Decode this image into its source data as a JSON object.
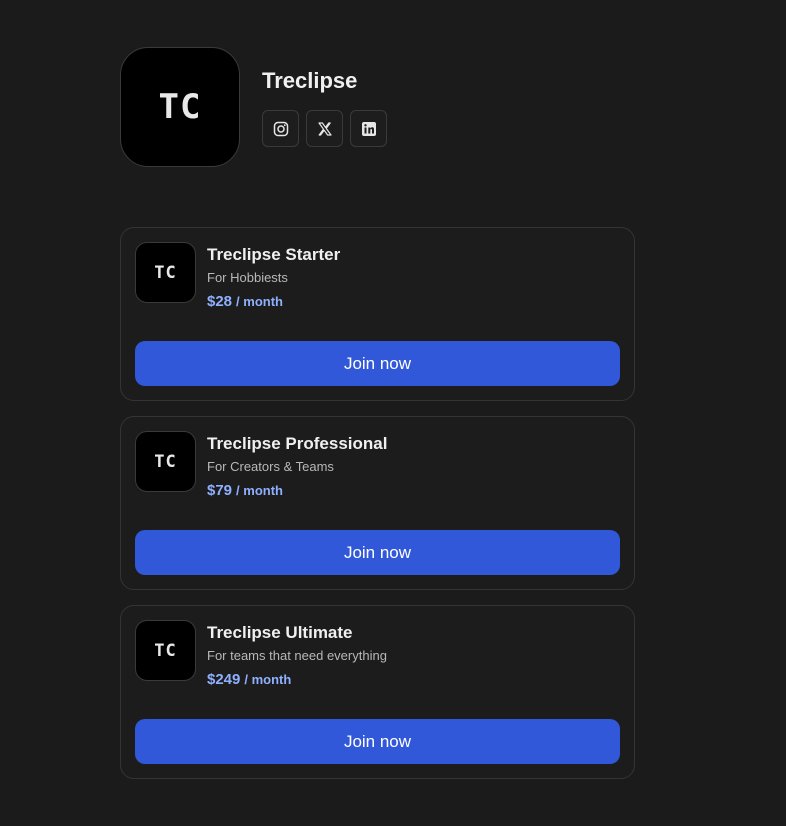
{
  "profile": {
    "logo_text": "TC",
    "name": "Treclipse",
    "socials": [
      {
        "icon": "instagram-icon"
      },
      {
        "icon": "x-twitter-icon"
      },
      {
        "icon": "linkedin-icon"
      }
    ]
  },
  "plans": [
    {
      "logo_text": "TC",
      "name": "Treclipse Starter",
      "description": "For Hobbiests",
      "price": "$28",
      "period": "/ month",
      "cta": "Join now"
    },
    {
      "logo_text": "TC",
      "name": "Treclipse Professional",
      "description": "For Creators & Teams",
      "price": "$79",
      "period": "/ month",
      "cta": "Join now"
    },
    {
      "logo_text": "TC",
      "name": "Treclipse Ultimate",
      "description": "For teams that need everything",
      "price": "$249",
      "period": "/ month",
      "cta": "Join now"
    }
  ],
  "colors": {
    "background": "#1b1b1c",
    "accent": "#3058d8",
    "price": "#8fb0ff"
  }
}
